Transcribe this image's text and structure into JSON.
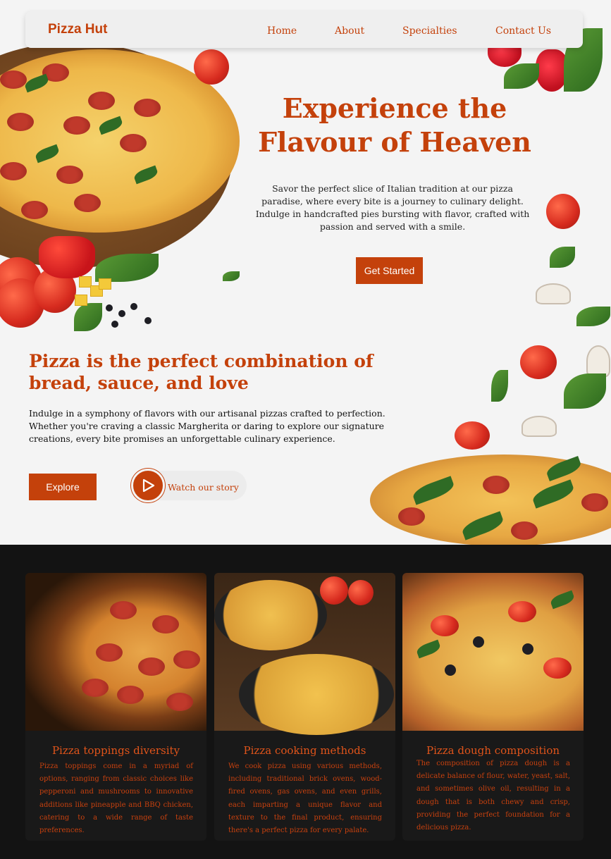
{
  "nav": {
    "brand": "Pizza Hut",
    "links": [
      "Home",
      "About",
      "Specialties",
      "Contact Us"
    ]
  },
  "hero": {
    "title_line1": "Experience the",
    "title_line2": "Flavour of Heaven",
    "text": "Savor the perfect slice of Italian tradition at our pizza paradise, where every bite is a journey to culinary delight. Indulge in handcrafted pies bursting with flavor, crafted with passion and served with a smile.",
    "cta": "Get Started"
  },
  "intro": {
    "title": "Pizza is the perfect combination of bread, sauce, and love",
    "text": "Indulge in a symphony of flavors with our artisanal pizzas crafted to perfection. Whether you're craving a classic Margherita or daring to explore our signature creations, every bite promises an unforgettable culinary experience.",
    "explore": "Explore",
    "watch": "Watch our story"
  },
  "cards": [
    {
      "title": "Pizza toppings diversity",
      "text": "Pizza toppings come in a myriad of options, ranging from classic choices like pepperoni and mushrooms to innovative additions like pineapple and BBQ chicken, catering to a wide range of taste preferences."
    },
    {
      "title": "Pizza cooking methods",
      "text": "We cook pizza using various methods, including traditional brick ovens, wood-fired ovens, gas ovens, and even grills, each imparting a unique flavor and texture to the final product, ensuring there's a perfect pizza for every palate."
    },
    {
      "title": "Pizza dough composition",
      "text": "The composition of pizza dough is a delicate balance of flour, water, yeast, salt, and sometimes olive oil, resulting in a dough that is both chewy and crisp, providing the perfect foundation for a delicious pizza."
    }
  ],
  "colors": {
    "accent": "#c4410b",
    "dark_bg": "#131313"
  }
}
